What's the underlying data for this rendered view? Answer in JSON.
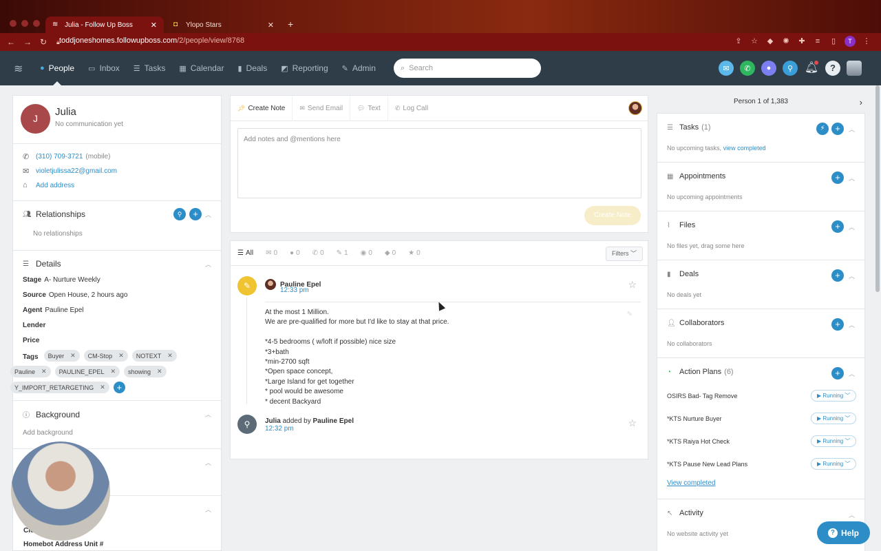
{
  "browser": {
    "tabs": [
      {
        "title": "Julia - Follow Up Boss",
        "active": true
      },
      {
        "title": "Ylopo Stars",
        "active": false
      }
    ],
    "url_host": "toddjoneshomes.followupboss.com",
    "url_path": "/2/people/view/8768",
    "profile_initial": "T"
  },
  "nav": {
    "items": [
      {
        "label": "People",
        "icon": "person-icon",
        "active": true
      },
      {
        "label": "Inbox",
        "icon": "inbox-icon"
      },
      {
        "label": "Tasks",
        "icon": "list-icon"
      },
      {
        "label": "Calendar",
        "icon": "calendar-icon"
      },
      {
        "label": "Deals",
        "icon": "deals-icon"
      },
      {
        "label": "Reporting",
        "icon": "chart-icon"
      },
      {
        "label": "Admin",
        "icon": "wrench-icon"
      }
    ],
    "search_placeholder": "Search",
    "icon_colors": [
      "#5bb8e8",
      "#2fb760",
      "#7b7ff0",
      "#3a9fd8"
    ]
  },
  "person": {
    "initial": "J",
    "name": "Julia",
    "status": "No communication yet",
    "phone": "(310) 709-3721",
    "phone_type": "(mobile)",
    "email": "violetjulissa22@gmail.com",
    "add_address": "Add address"
  },
  "left": {
    "relationships": {
      "title": "Relationships",
      "empty": "No relationships"
    },
    "details": {
      "title": "Details",
      "rows": [
        {
          "label": "Stage",
          "value": "A- Nurture Weekly"
        },
        {
          "label": "Source",
          "value": "Open House, 2 hours ago"
        },
        {
          "label": "Agent",
          "value": "Pauline Epel"
        },
        {
          "label": "Lender",
          "value": ""
        },
        {
          "label": "Price",
          "value": ""
        }
      ],
      "tags_label": "Tags",
      "tags": [
        "Buyer",
        "CM-Stop",
        "NOTEXT",
        "Pauline",
        "PAULINE_EPEL",
        "showing",
        "Y_IMPORT_RETARGETING"
      ]
    },
    "background": {
      "title": "Background",
      "empty": "Add background"
    },
    "partial_label_1": "Clo",
    "partial_label_2": "Homebot Address Unit #"
  },
  "composer": {
    "tabs": [
      {
        "label": "Create Note",
        "active": true
      },
      {
        "label": "Send Email"
      },
      {
        "label": "Text"
      },
      {
        "label": "Log Call"
      }
    ],
    "placeholder": "Add notes and @mentions here",
    "button": "Create Note"
  },
  "timeline": {
    "tabs": [
      {
        "label": "All",
        "icon": "list-icon",
        "active": true
      },
      {
        "label": "0",
        "icon": "email-icon"
      },
      {
        "label": "0",
        "icon": "chat-icon"
      },
      {
        "label": "0",
        "icon": "phone-icon"
      },
      {
        "label": "1",
        "icon": "pin-icon"
      },
      {
        "label": "0",
        "icon": "chats-icon"
      },
      {
        "label": "0",
        "icon": "drop-icon"
      },
      {
        "label": "0",
        "icon": "star-icon"
      }
    ],
    "filters": "Filters",
    "note": {
      "author": "Pauline Epel",
      "time": "12:33 pm",
      "lines": [
        "At the most 1 Million.",
        "We are pre-qualified for more but I'd like to stay at that price.",
        "",
        "*4-5 bedrooms ( w/loft if possible) nice size",
        "*3+bath",
        "*min-2700 sqft",
        "*Open space concept,",
        "*Large Island for get together",
        "* pool would be awesome",
        "* decent Backyard"
      ]
    },
    "added": {
      "subject": "Julia",
      "verb": "added by",
      "agent": "Pauline Epel",
      "time": "12:32 pm"
    }
  },
  "right": {
    "pager": "Person 1 of 1,383",
    "tasks": {
      "title": "Tasks",
      "count": "(1)",
      "empty": "No upcoming tasks,",
      "link": "view completed"
    },
    "appointments": {
      "title": "Appointments",
      "empty": "No upcoming appointments"
    },
    "files": {
      "title": "Files",
      "empty": "No files yet, drag some here"
    },
    "deals": {
      "title": "Deals",
      "empty": "No deals yet"
    },
    "collaborators": {
      "title": "Collaborators",
      "empty": "No collaborators"
    },
    "action_plans": {
      "title": "Action Plans",
      "count": "(6)",
      "plans": [
        {
          "name": "OSIRS Bad- Tag Remove",
          "status": "Running"
        },
        {
          "name": "*KTS Nurture Buyer",
          "status": "Running"
        },
        {
          "name": "*KTS Raiya Hot Check",
          "status": "Running"
        },
        {
          "name": "*KTS Pause New Lead Plans",
          "status": "Running"
        }
      ],
      "view_completed": "View completed"
    },
    "activity": {
      "title": "Activity",
      "empty": "No website activity yet"
    }
  },
  "help": "Help"
}
